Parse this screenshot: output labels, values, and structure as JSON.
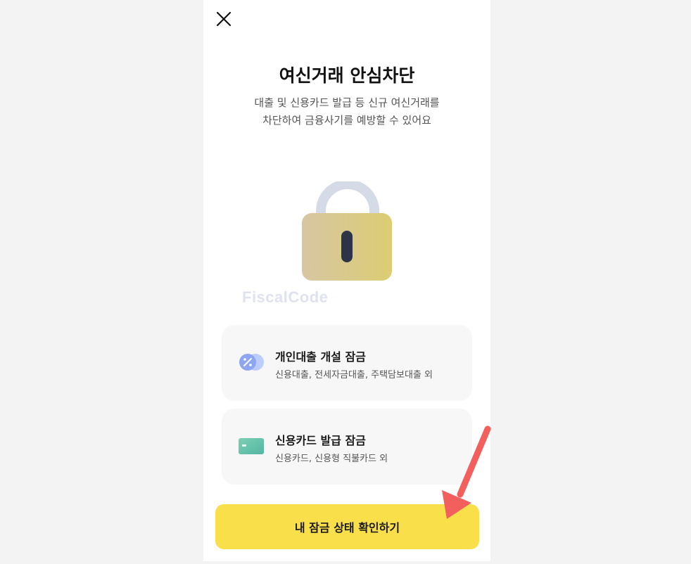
{
  "page": {
    "title": "여신거래 안심차단",
    "subtitle_line1": "대출 및 신용카드 발급 등 신규 여신거래를",
    "subtitle_line2": "차단하여 금융사기를 예방할 수 있어요",
    "watermark": "FiscalCode"
  },
  "icons": {
    "close": "close-icon",
    "lock": "padlock-icon",
    "loan": "percent-coin-icon",
    "card": "credit-card-icon"
  },
  "cards": [
    {
      "title": "개인대출 개설 잠금",
      "desc": "신용대출, 전세자금대출, 주택담보대출 외"
    },
    {
      "title": "신용카드 발급 잠금",
      "desc": "신용카드, 신용형 직불카드 외"
    }
  ],
  "cta": {
    "label": "내 잠금 상태 확인하기"
  },
  "colors": {
    "accent_yellow": "#f9e04b",
    "arrow_red": "#f25f5c",
    "lock_body_start": "#d7c6a3",
    "lock_body_end": "#dccd73",
    "lock_shackle": "#d5dbe6"
  }
}
